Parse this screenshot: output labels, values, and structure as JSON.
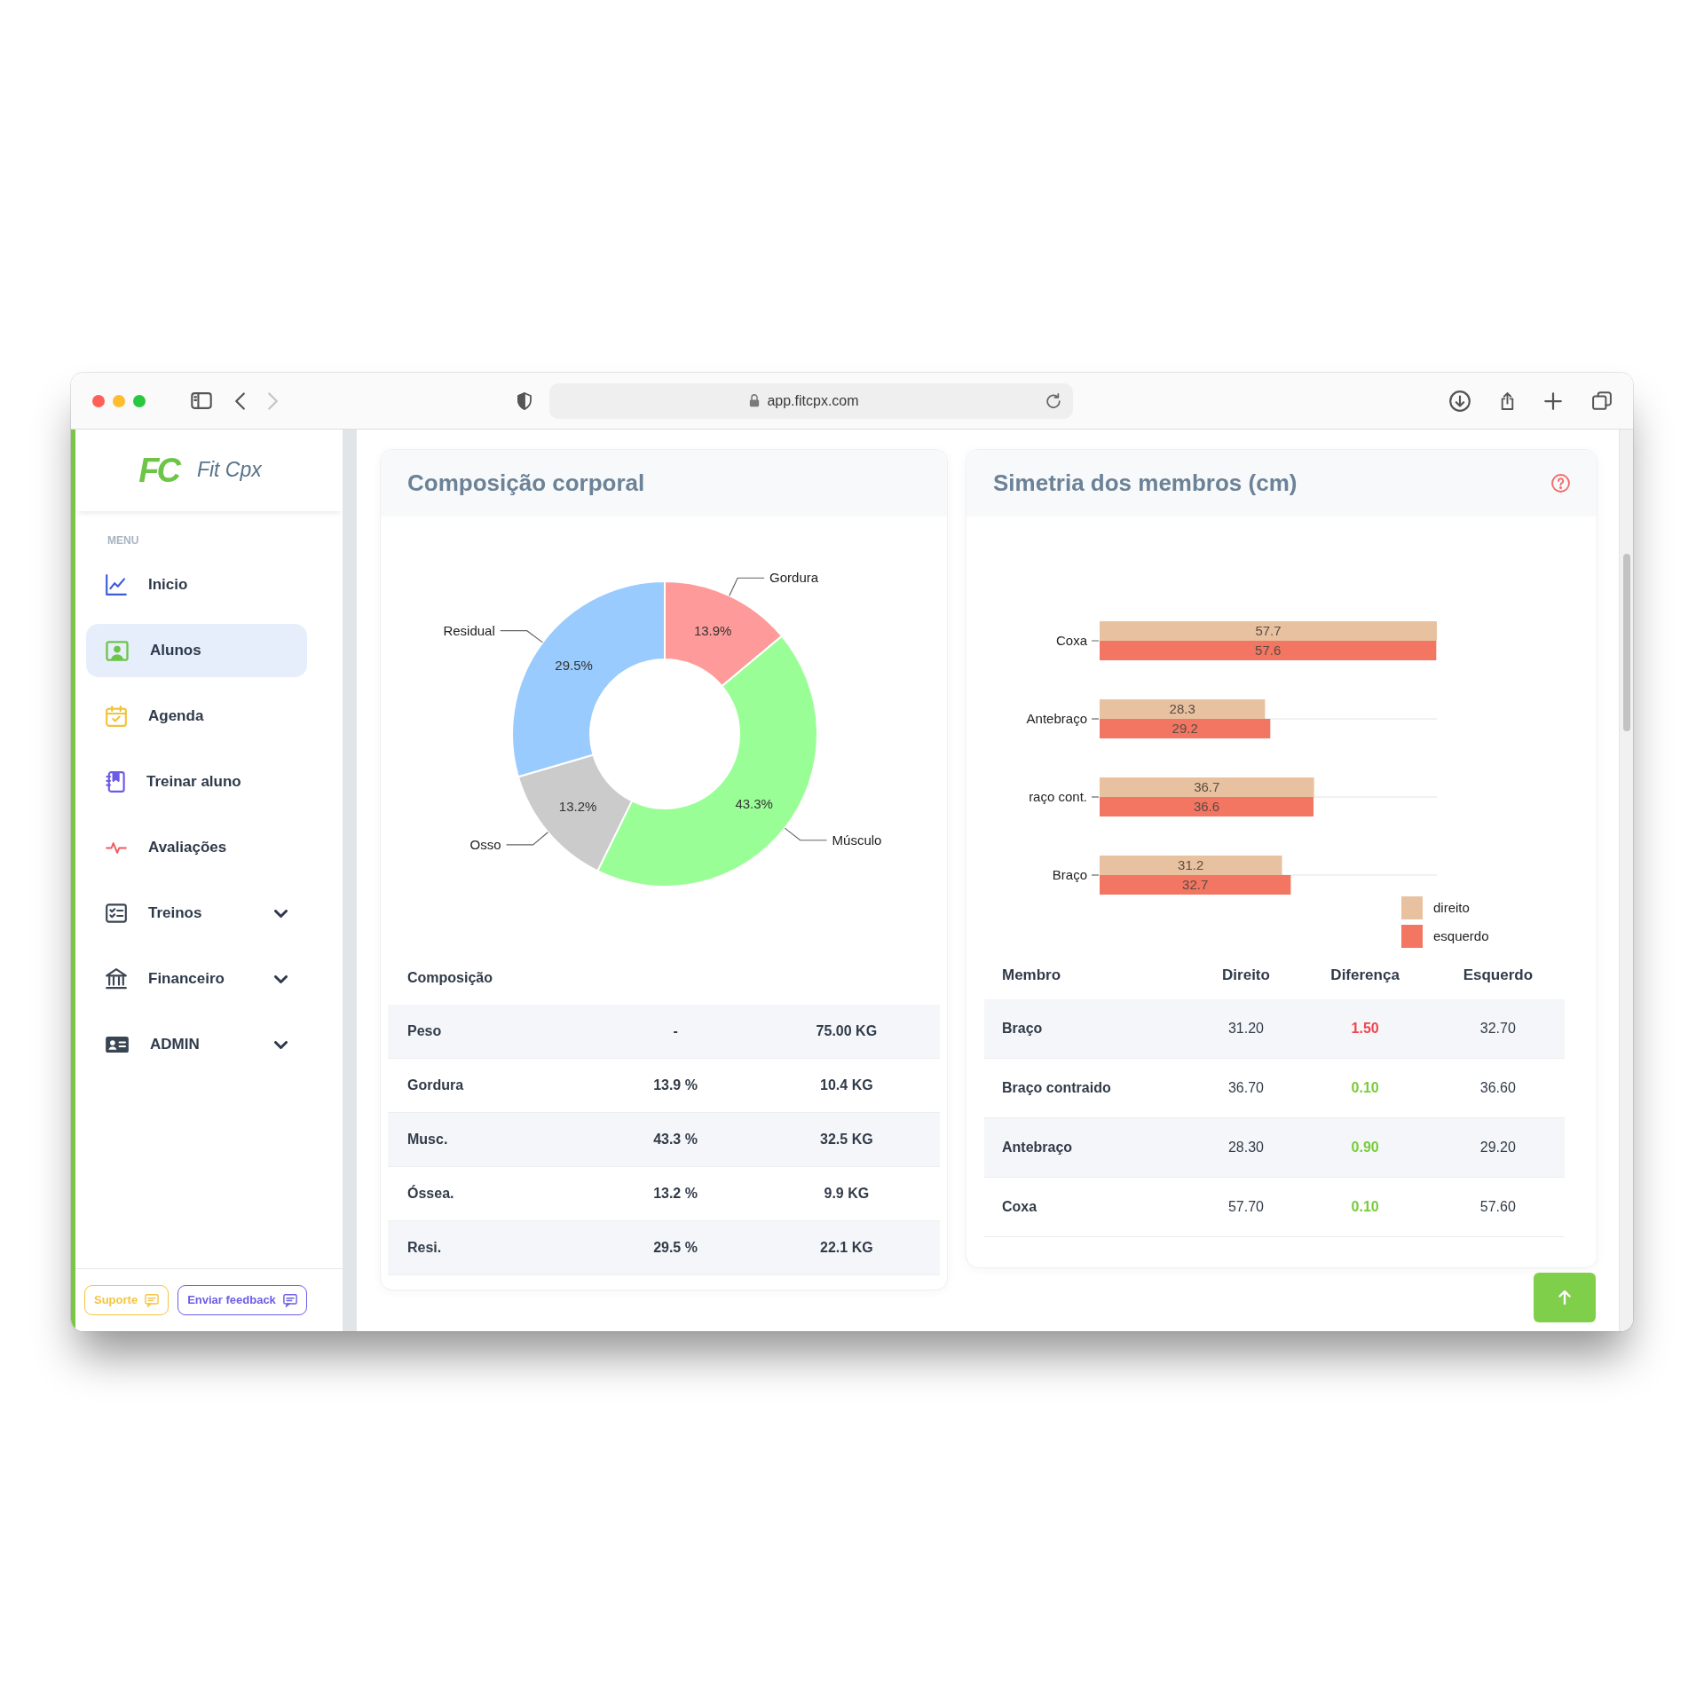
{
  "browser": {
    "nav_buttons": [
      {
        "kind": "back",
        "disabled": false
      },
      {
        "kind": "forward",
        "disabled": true
      }
    ],
    "url": "app.fitcpx.com"
  },
  "sidebar": {
    "logo_mark": "FC",
    "brand": "Fit Cpx",
    "section_label": "MENU",
    "items": [
      {
        "label": "Inicio",
        "kind": "link",
        "selected": false
      },
      {
        "label": "Alunos",
        "kind": "link",
        "selected": true
      },
      {
        "label": "Agenda",
        "kind": "link",
        "selected": false
      },
      {
        "label": "Treinar aluno",
        "kind": "link",
        "selected": false
      },
      {
        "label": "Avaliações",
        "kind": "link",
        "selected": false
      },
      {
        "label": "Treinos",
        "kind": "dropdown",
        "selected": false
      },
      {
        "label": "Financeiro",
        "kind": "dropdown",
        "selected": false
      },
      {
        "label": "ADMIN",
        "kind": "dropdown",
        "selected": false
      }
    ],
    "footer_buttons": [
      {
        "label": "Suporte",
        "color": "#f3c443"
      },
      {
        "label": "Enviar feedback",
        "color": "#6a5de8"
      }
    ]
  },
  "composition": {
    "title": "Composição corporal",
    "chart_data": {
      "type": "donut",
      "categories": [
        "Gordura",
        "Músculo",
        "Osso",
        "Residual"
      ],
      "values": [
        13.9,
        43.3,
        13.2,
        29.5
      ],
      "value_labels": [
        "13.9%",
        "43.3%",
        "13.2%",
        "29.5%"
      ]
    },
    "table": {
      "columns": [
        "Composição"
      ],
      "rows": [
        [
          "Peso",
          "-",
          "75.00 KG"
        ],
        [
          "Gordura",
          "13.9 %",
          "10.4 KG"
        ],
        [
          "Musc.",
          "43.3 %",
          "32.5 KG"
        ],
        [
          "Óssea.",
          "13.2 %",
          "9.9 KG"
        ],
        [
          "Resi.",
          "29.5 %",
          "22.1 KG"
        ]
      ]
    }
  },
  "symmetry": {
    "title": "Simetria dos membros (cm)",
    "chart_data": {
      "type": "bar",
      "orientation": "horizontal",
      "categories": [
        "Coxa",
        "Antebraço",
        "raço cont.",
        "Braço"
      ],
      "series": [
        {
          "name": "direito",
          "color": "#e8c2a0",
          "values": [
            57.7,
            28.3,
            36.7,
            31.2
          ]
        },
        {
          "name": "esquerdo",
          "color": "#f27662",
          "values": [
            57.6,
            29.2,
            36.6,
            32.7
          ]
        }
      ],
      "data_labels": true,
      "grid": true,
      "legend": "right"
    },
    "table": {
      "columns": [
        "Membro",
        "Direito",
        "Diferença",
        "Esquerdo"
      ],
      "rows": [
        {
          "membro": "Braço",
          "direito": "31.20",
          "diferenca": {
            "value": "1.50",
            "color": "#f0454c"
          },
          "esquerdo": "32.70"
        },
        {
          "membro": "Braço contraido",
          "direito": "36.70",
          "diferenca": {
            "value": "0.10",
            "color": "#79cc3a"
          },
          "esquerdo": "36.60"
        },
        {
          "membro": "Antebraço",
          "direito": "28.30",
          "diferenca": {
            "value": "0.90",
            "color": "#79cc3a"
          },
          "esquerdo": "29.20"
        },
        {
          "membro": "Coxa",
          "direito": "57.70",
          "diferenca": {
            "value": "0.10",
            "color": "#79cc3a"
          },
          "esquerdo": "57.60"
        }
      ]
    }
  }
}
